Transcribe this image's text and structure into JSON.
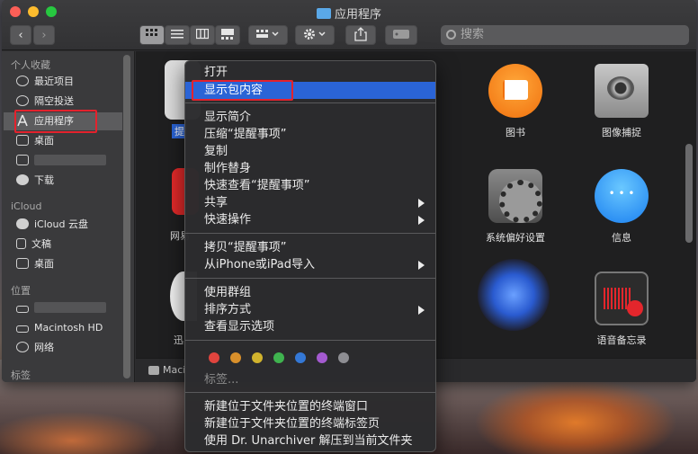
{
  "window": {
    "title": "应用程序"
  },
  "toolbar": {
    "back": "‹",
    "forward": "›",
    "search_placeholder": "搜索"
  },
  "sidebar": {
    "favorites_header": "个人收藏",
    "favorites": [
      {
        "label": "最近项目",
        "icon": "clock-icon"
      },
      {
        "label": "隔空投送",
        "icon": "airdrop-icon"
      },
      {
        "label": "应用程序",
        "icon": "applications-icon"
      },
      {
        "label": "桌面",
        "icon": "desktop-icon"
      },
      {
        "label": "",
        "icon": "home-icon"
      },
      {
        "label": "下载",
        "icon": "download-icon"
      }
    ],
    "icloud_header": "iCloud",
    "icloud": [
      {
        "label": "iCloud 云盘",
        "icon": "cloud-icon"
      },
      {
        "label": "文稿",
        "icon": "document-icon"
      },
      {
        "label": "桌面",
        "icon": "desktop-icon"
      }
    ],
    "locations_header": "位置",
    "locations": [
      {
        "label": "",
        "icon": "disk-icon"
      },
      {
        "label": "Macintosh HD",
        "icon": "disk-icon"
      },
      {
        "label": "网络",
        "icon": "network-icon"
      }
    ],
    "tags_header": "标签"
  },
  "content": {
    "apps": [
      {
        "label": "图书",
        "icon": "books-icon"
      },
      {
        "label": "图像捕捉",
        "icon": "image-capture-icon"
      },
      {
        "label": "系统偏好设置",
        "icon": "system-preferences-icon"
      },
      {
        "label": "信息",
        "icon": "messages-icon"
      },
      {
        "label": "语音备忘录",
        "icon": "voice-memos-icon"
      }
    ],
    "partial_labels": [
      "提",
      "网易",
      "迅"
    ],
    "pathbar": "Maci"
  },
  "context_menu": {
    "group1": [
      "打开",
      "显示包内容"
    ],
    "group2": [
      "显示简介",
      "压缩“提醒事项”",
      "复制",
      "制作替身",
      "快速查看“提醒事项”",
      "共享",
      "快速操作"
    ],
    "group3": [
      "拷贝“提醒事项”",
      "从iPhone或iPad导入"
    ],
    "group4": [
      "使用群组",
      "排序方式",
      "查看显示选项"
    ],
    "tags_label": "标签...",
    "tag_colors": [
      "#e0443e",
      "#d9902b",
      "#d1b32d",
      "#3fb34f",
      "#3478d6",
      "#a45ad0",
      "#8e8e93"
    ],
    "group6": [
      "新建位于文件夹位置的终端窗口",
      "新建位于文件夹位置的终端标签页",
      "使用 Dr. Unarchiver 解压到当前文件夹"
    ]
  }
}
